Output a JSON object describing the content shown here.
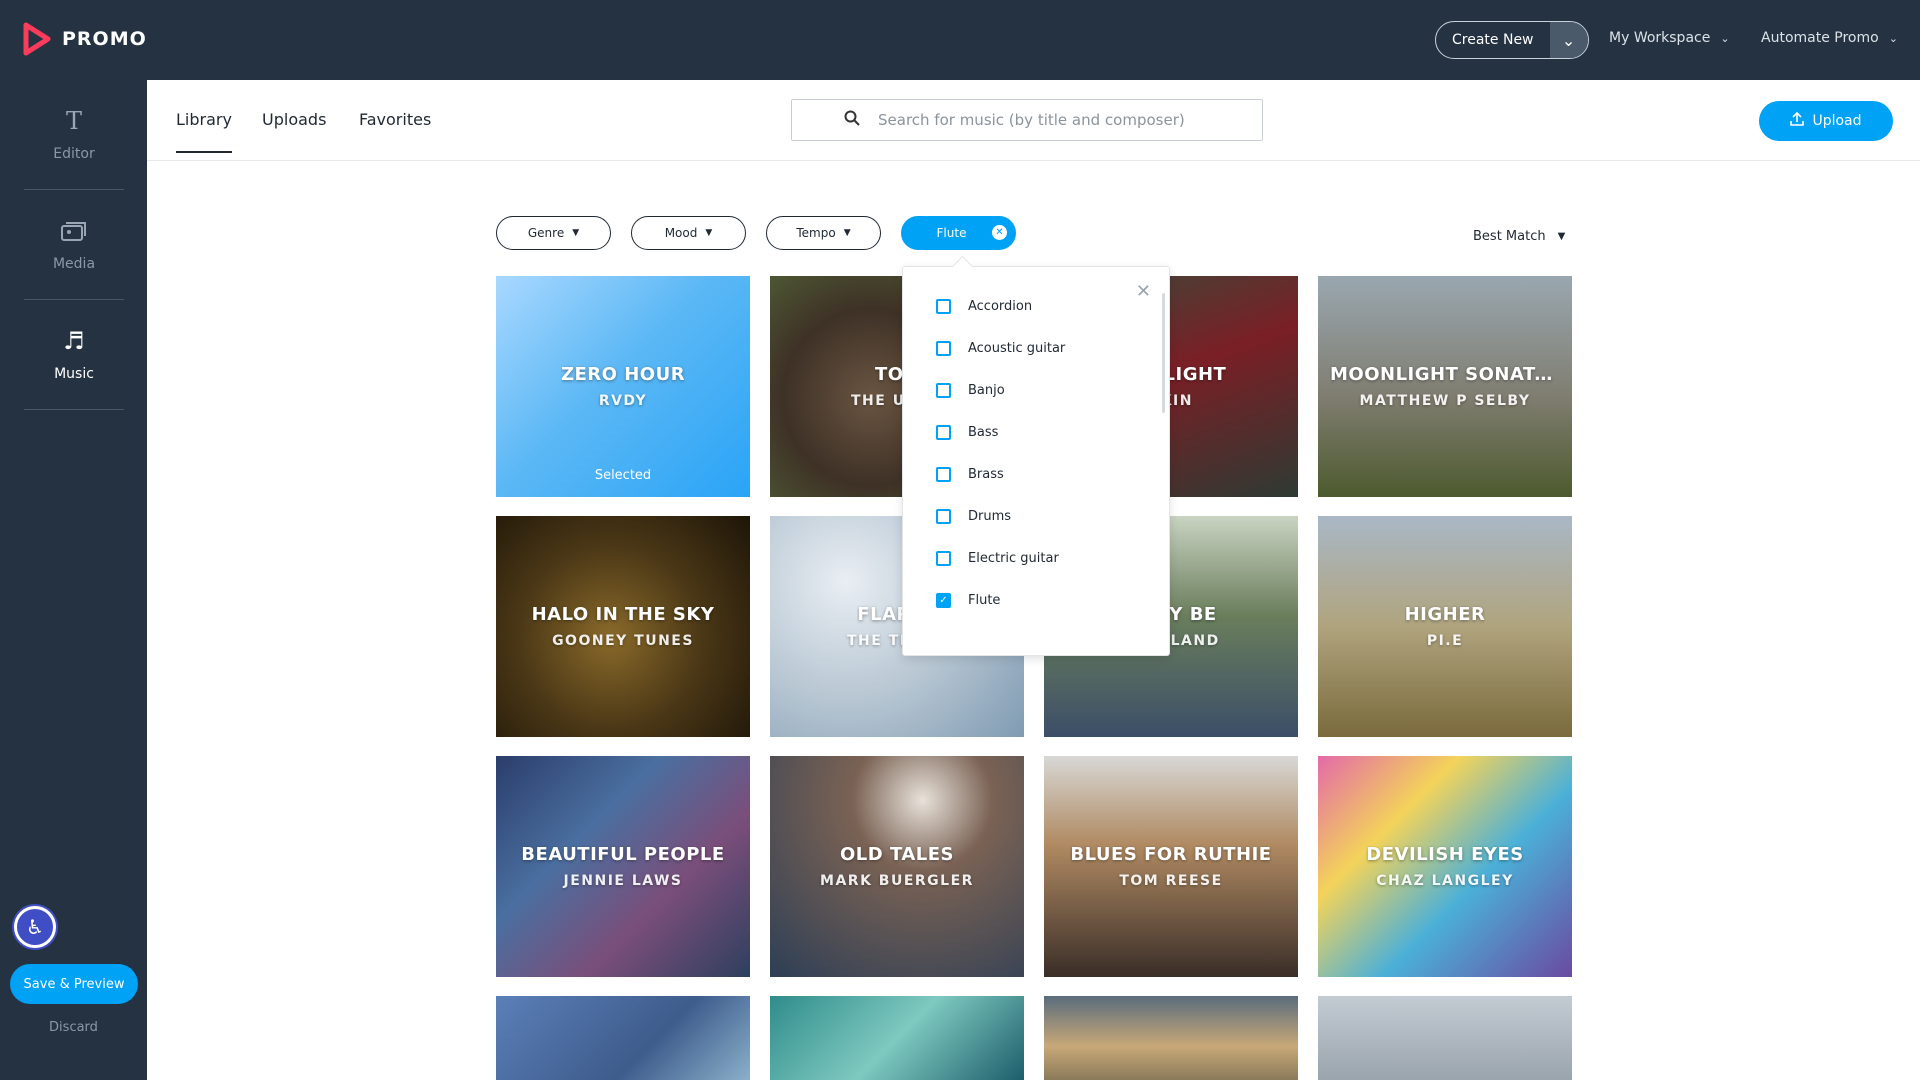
{
  "app": {
    "logo_text": "PROMO"
  },
  "topbar": {
    "create_new": "Create New",
    "workspace": "My Workspace",
    "automate": "Automate Promo"
  },
  "sidebar": {
    "items": [
      {
        "label": "Editor",
        "icon": "text-t-icon",
        "active": false
      },
      {
        "label": "Media",
        "icon": "media-stack-icon",
        "active": false
      },
      {
        "label": "Music",
        "icon": "music-note-icon",
        "active": true
      }
    ],
    "save_preview": "Save & Preview",
    "discard": "Discard"
  },
  "tabs": [
    {
      "label": "Library",
      "active": true
    },
    {
      "label": "Uploads",
      "active": false
    },
    {
      "label": "Favorites",
      "active": false
    }
  ],
  "search": {
    "placeholder": "Search for music (by title and composer)",
    "value": ""
  },
  "upload_label": "Upload",
  "filters": [
    {
      "label": "Genre",
      "active": false
    },
    {
      "label": "Mood",
      "active": false
    },
    {
      "label": "Tempo",
      "active": false
    },
    {
      "label": "Flute",
      "active": true
    }
  ],
  "sort": {
    "label": "Best Match"
  },
  "dropdown": {
    "items": [
      {
        "label": "Accordion",
        "checked": false
      },
      {
        "label": "Acoustic guitar",
        "checked": false
      },
      {
        "label": "Banjo",
        "checked": false
      },
      {
        "label": "Bass",
        "checked": false
      },
      {
        "label": "Brass",
        "checked": false
      },
      {
        "label": "Drums",
        "checked": false
      },
      {
        "label": "Electric guitar",
        "checked": false
      },
      {
        "label": "Flute",
        "checked": true
      }
    ]
  },
  "tracks": [
    {
      "title": "ZERO HOUR",
      "artist": "RVDY",
      "selected": true,
      "selected_label": "Selected"
    },
    {
      "title": "TOD",
      "artist": "THE UNDE"
    },
    {
      "title": "THE LIGHT",
      "artist": "SKIN"
    },
    {
      "title": "MOONLIGHT SONATA ...",
      "artist": "MATTHEW P SELBY"
    },
    {
      "title": "HALO IN THE SKY",
      "artist": "GOONEY TUNES"
    },
    {
      "title": "FLAPPE",
      "artist": "THE TEXAS"
    },
    {
      "title": "BODY BE",
      "artist": "CHERLAND"
    },
    {
      "title": "HIGHER",
      "artist": "PI.E"
    },
    {
      "title": "BEAUTIFUL PEOPLE",
      "artist": "JENNIE LAWS"
    },
    {
      "title": "OLD TALES",
      "artist": "MARK BUERGLER"
    },
    {
      "title": "BLUES FOR RUTHIE",
      "artist": "TOM REESE"
    },
    {
      "title": "DEVILISH EYES",
      "artist": "CHAZ LANGLEY"
    },
    {
      "title": "",
      "artist": ""
    },
    {
      "title": "",
      "artist": ""
    },
    {
      "title": "",
      "artist": ""
    },
    {
      "title": "",
      "artist": ""
    }
  ],
  "colors": {
    "nav_bg": "#243241",
    "accent": "#00a2f5"
  }
}
